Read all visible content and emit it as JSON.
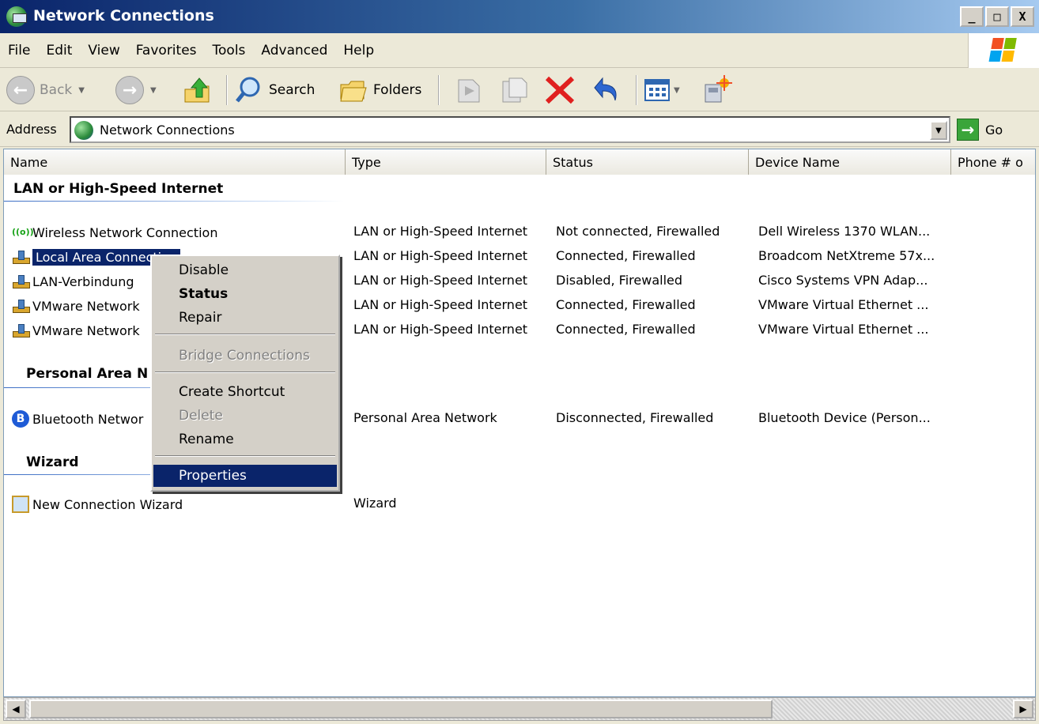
{
  "window": {
    "title": "Network Connections",
    "caption_buttons": [
      "_",
      "□",
      "X"
    ]
  },
  "menu": [
    "File",
    "Edit",
    "View",
    "Favorites",
    "Tools",
    "Advanced",
    "Help"
  ],
  "toolbar": {
    "back_label": "Back",
    "search_label": "Search",
    "folders_label": "Folders"
  },
  "address": {
    "label": "Address",
    "value": "Network Connections",
    "go_label": "Go"
  },
  "columns": [
    "Name",
    "Type",
    "Status",
    "Device Name",
    "Phone # o"
  ],
  "groups": [
    {
      "title": "LAN or High-Speed Internet",
      "rows": [
        {
          "icon": "wireless-icon",
          "name": "Wireless Network Connection",
          "type": "LAN or High-Speed Internet",
          "status": "Not connected, Firewalled",
          "device": "Dell Wireless 1370 WLAN..."
        },
        {
          "icon": "network-icon",
          "name": "Local Area Connection",
          "type": "LAN or High-Speed Internet",
          "status": "Connected, Firewalled",
          "device": "Broadcom NetXtreme 57x..."
        },
        {
          "icon": "network-icon",
          "name": "LAN-Verbindung",
          "type": "LAN or High-Speed Internet",
          "status": "Disabled, Firewalled",
          "device": "Cisco Systems VPN Adap..."
        },
        {
          "icon": "network-icon",
          "name": "VMware Network",
          "type": "LAN or High-Speed Internet",
          "status": "Connected, Firewalled",
          "device": "VMware Virtual Ethernet ..."
        },
        {
          "icon": "network-icon",
          "name": "VMware Network",
          "type": "LAN or High-Speed Internet",
          "status": "Connected, Firewalled",
          "device": "VMware Virtual Ethernet ..."
        }
      ]
    },
    {
      "title": "Personal Area N",
      "rows": [
        {
          "icon": "bluetooth-icon",
          "name": "Bluetooth Networ",
          "type": "Personal Area Network",
          "status": "Disconnected, Firewalled",
          "device": "Bluetooth Device (Person..."
        }
      ]
    },
    {
      "title": "Wizard",
      "rows": [
        {
          "icon": "wizard-icon",
          "name": "New Connection Wizard",
          "type": "Wizard",
          "status": "",
          "device": ""
        }
      ]
    }
  ],
  "context_menu": [
    {
      "label": "Disable",
      "state": "normal"
    },
    {
      "label": "Status",
      "state": "bold"
    },
    {
      "label": "Repair",
      "state": "normal"
    },
    {
      "label": "Bridge Connections",
      "state": "disabled"
    },
    {
      "label": "Create Shortcut",
      "state": "normal"
    },
    {
      "label": "Delete",
      "state": "disabled"
    },
    {
      "label": "Rename",
      "state": "normal"
    },
    {
      "label": "Properties",
      "state": "highlighted"
    }
  ],
  "colors": {
    "selection": "#0A246A",
    "title_start": "#0A246A",
    "chrome": "#ECE9D8"
  }
}
